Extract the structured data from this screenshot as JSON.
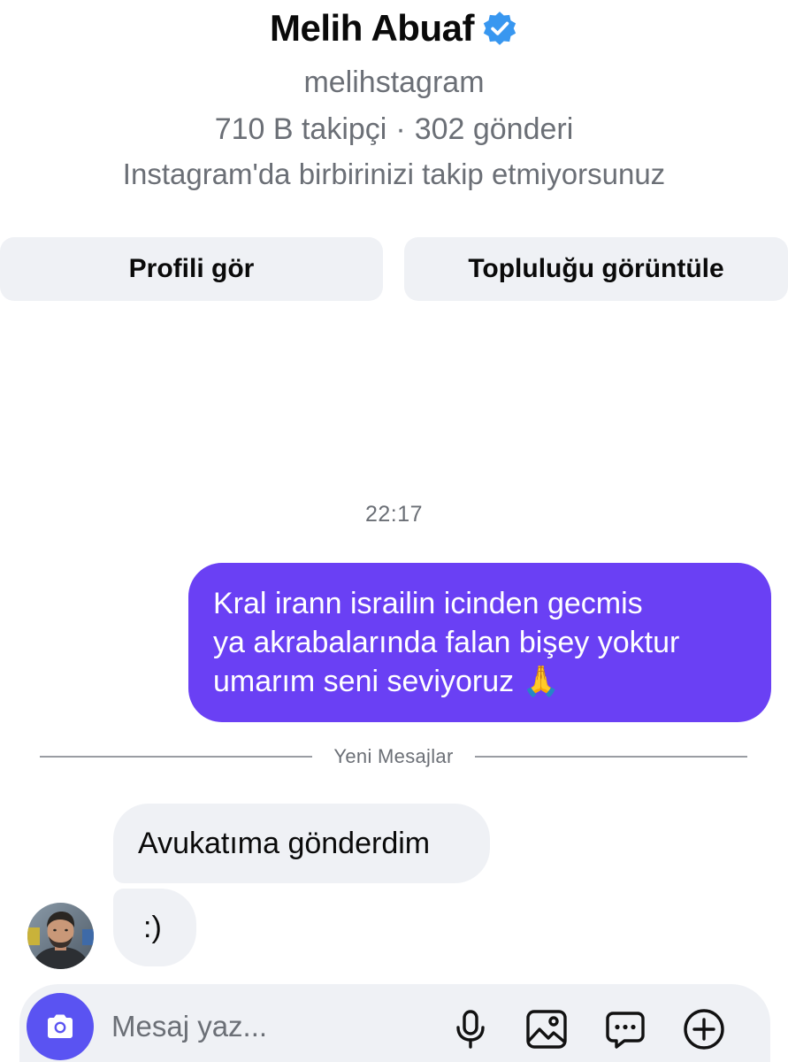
{
  "profile": {
    "name": "Melih Abuaf",
    "verified_icon": "verified-badge-icon",
    "username": "melihstagram",
    "followers": "710 B takipçi",
    "stats_separator": "·",
    "posts": "302 gönderi",
    "follow_note": "Instagram'da birbirinizi takip etmiyorsunuz"
  },
  "actions": {
    "view_profile": "Profili gör",
    "view_community": "Topluluğu görüntüle"
  },
  "conversation": {
    "timestamp": "22:17",
    "sent_message": {
      "lines": [
        "Kral irann israilin icinden gecmis",
        "ya akrabalarında falan bişey yoktur",
        "umarım seni seviyoruz 🙏"
      ]
    },
    "new_messages_label": "Yeni Mesajlar",
    "received_messages": [
      "Avukatıma gönderdim",
      ":)"
    ]
  },
  "composer": {
    "placeholder": "Mesaj yaz...",
    "icons": [
      "camera-icon",
      "microphone-icon",
      "gallery-icon",
      "sticker-icon",
      "plus-icon"
    ]
  },
  "colors": {
    "sent_bubble": "#6a40f4",
    "received_bubble": "#eff1f5",
    "camera_button": "#5a53f2",
    "verified_badge": "#3897f0",
    "secondary_text": "#6b6f76"
  }
}
